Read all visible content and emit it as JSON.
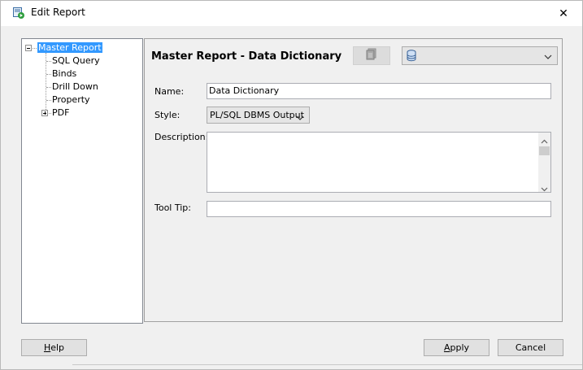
{
  "window": {
    "title": "Edit Report",
    "close_glyph": "✕"
  },
  "tree": {
    "root": "Master Report",
    "children": [
      "SQL Query",
      "Binds",
      "Drill Down",
      "Property",
      "PDF"
    ]
  },
  "detail": {
    "title": "Master Report - Data Dictionary",
    "connection_value": "",
    "name_label": "Name:",
    "name_value": "Data Dictionary",
    "style_label": "Style:",
    "style_value": "PL/SQL DBMS Output",
    "description_label": "Description:",
    "description_value": "",
    "tooltip_label": "Tool Tip:",
    "tooltip_value": ""
  },
  "buttons": {
    "help": "Help",
    "apply": "Apply",
    "cancel": "Cancel"
  },
  "icons": {
    "title": "report-run-icon",
    "toolbar": "report-icon",
    "connection": "database-icon"
  },
  "colors": {
    "selection": "#3399ff",
    "window_bg": "#f0f0f0"
  }
}
